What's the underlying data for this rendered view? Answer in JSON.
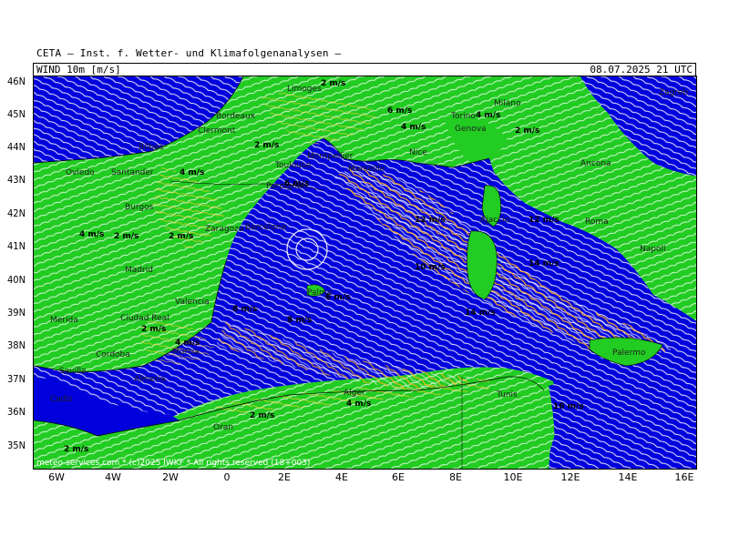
{
  "header": {
    "institute": "CETA — Inst. f. Wetter- und Klimafolgenanalysen —",
    "product": "WIND 10m [m/s]",
    "valid_time": "08.07.2025 21 UTC"
  },
  "axes": {
    "lat_labels": [
      "46N",
      "45N",
      "44N",
      "43N",
      "42N",
      "41N",
      "40N",
      "39N",
      "38N",
      "37N",
      "36N",
      "35N"
    ],
    "lon_labels": [
      "6W",
      "4W",
      "2W",
      "0",
      "2E",
      "4E",
      "6E",
      "8E",
      "10E",
      "12E",
      "14E",
      "16E"
    ]
  },
  "credit": "meteo-services.com * (c)2025 IWKF * All rights reserved (18+003)",
  "colors": {
    "sea_strong": "#0000dd",
    "land_weak": "#22cc22",
    "moderate": "#aadd22",
    "strong_streamlines": "#ffb020",
    "weak_streamlines": "#ffffff"
  },
  "cities": [
    "Limoges",
    "Bordeaux",
    "Clermont",
    "Milano",
    "Torino",
    "Genova",
    "Zagreb",
    "Ancona",
    "Bilbao",
    "Toulouse",
    "Nice",
    "Marseille",
    "Montpellier",
    "Perpignan",
    "Oviedo",
    "Santander",
    "Burgos",
    "Zaragoza",
    "Barcelona",
    "Ajaccio",
    "Roma",
    "Napoli",
    "Madrid",
    "Valencia",
    "Palma",
    "Ciudad Real",
    "Merida",
    "Cordoba",
    "Murcia",
    "Sevilla",
    "Almeria",
    "Cadiz",
    "Oran",
    "Alger",
    "Tunis",
    "Palermo"
  ],
  "wind_labels": [
    "2 m/s",
    "4 m/s",
    "6 m/s",
    "8 m/s",
    "10 m/s",
    "12 m/s",
    "14 m/s",
    "16 m/s"
  ]
}
